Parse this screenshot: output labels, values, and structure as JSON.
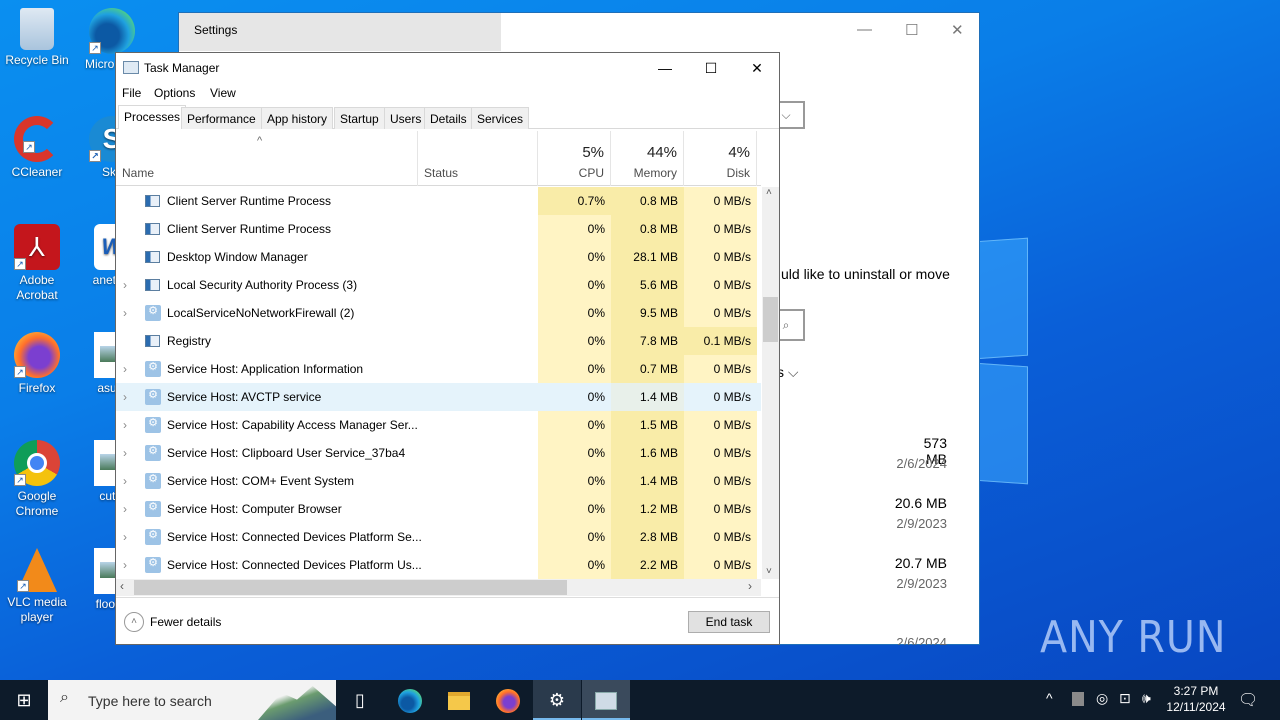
{
  "desktop": {
    "icons": [
      {
        "label": "Recycle Bin",
        "icon": "recycle-bin-icon"
      },
      {
        "label": "Micro Edg",
        "icon": "edge-icon"
      },
      {
        "label": "CCleaner",
        "icon": "ccleaner-icon"
      },
      {
        "label": "Sky",
        "icon": "skype-icon"
      },
      {
        "label": "Adobe Acrobat",
        "icon": "acrobat-icon"
      },
      {
        "label": "anetwo",
        "icon": "word-doc-icon"
      },
      {
        "label": "Firefox",
        "icon": "firefox-icon"
      },
      {
        "label": "asusr",
        "icon": "image-file-icon"
      },
      {
        "label": "Google Chrome",
        "icon": "chrome-icon"
      },
      {
        "label": "cuthi",
        "icon": "image-file-icon"
      },
      {
        "label": "VLC media player",
        "icon": "vlc-icon"
      },
      {
        "label": "floorin",
        "icon": "image-file-icon"
      }
    ],
    "watermark": "ANY RUN"
  },
  "settings_window": {
    "title": "Settings",
    "minimize": "—",
    "maximize": "☐",
    "close": "✕",
    "partial_text": "uld like to uninstall or move",
    "sort_partial": "s",
    "apps": [
      {
        "size": "573 MB",
        "date": "2/6/2024"
      },
      {
        "size": "20.6 MB",
        "date": "2/9/2023"
      },
      {
        "size": "20.7 MB",
        "date": "2/9/2023"
      },
      {
        "size": "",
        "date": "2/6/2024"
      }
    ]
  },
  "task_manager": {
    "title": "Task Manager",
    "window_controls": {
      "minimize": "—",
      "maximize": "☐",
      "close": "✕"
    },
    "menu": [
      "File",
      "Options",
      "View"
    ],
    "tabs": [
      "Processes",
      "Performance",
      "App history",
      "Startup",
      "Users",
      "Details",
      "Services"
    ],
    "active_tab": "Processes",
    "columns": {
      "name": "Name",
      "status": "Status",
      "cpu": {
        "label": "CPU",
        "total": "5%"
      },
      "memory": {
        "label": "Memory",
        "total": "44%"
      },
      "disk": {
        "label": "Disk",
        "total": "4%"
      }
    },
    "processes": [
      {
        "name": "Client Server Runtime Process",
        "icon": "window-icon",
        "expandable": false,
        "cpu": "0.7%",
        "memory": "0.8 MB",
        "disk": "0 MB/s"
      },
      {
        "name": "Client Server Runtime Process",
        "icon": "window-icon",
        "expandable": false,
        "cpu": "0%",
        "memory": "0.8 MB",
        "disk": "0 MB/s"
      },
      {
        "name": "Desktop Window Manager",
        "icon": "window-icon",
        "expandable": false,
        "cpu": "0%",
        "memory": "28.1 MB",
        "disk": "0 MB/s"
      },
      {
        "name": "Local Security Authority Process (3)",
        "icon": "window-icon",
        "expandable": true,
        "cpu": "0%",
        "memory": "5.6 MB",
        "disk": "0 MB/s"
      },
      {
        "name": "LocalServiceNoNetworkFirewall (2)",
        "icon": "gear-icon",
        "expandable": true,
        "cpu": "0%",
        "memory": "9.5 MB",
        "disk": "0 MB/s"
      },
      {
        "name": "Registry",
        "icon": "window-icon",
        "expandable": false,
        "cpu": "0%",
        "memory": "7.8 MB",
        "disk": "0.1 MB/s"
      },
      {
        "name": "Service Host: Application Information",
        "icon": "gear-icon",
        "expandable": true,
        "cpu": "0%",
        "memory": "0.7 MB",
        "disk": "0 MB/s"
      },
      {
        "name": "Service Host: AVCTP service",
        "icon": "gear-icon",
        "expandable": true,
        "cpu": "0%",
        "memory": "1.4 MB",
        "disk": "0 MB/s",
        "selected": true
      },
      {
        "name": "Service Host: Capability Access Manager Ser...",
        "icon": "gear-icon",
        "expandable": true,
        "cpu": "0%",
        "memory": "1.5 MB",
        "disk": "0 MB/s"
      },
      {
        "name": "Service Host: Clipboard User Service_37ba4",
        "icon": "gear-icon",
        "expandable": true,
        "cpu": "0%",
        "memory": "1.6 MB",
        "disk": "0 MB/s"
      },
      {
        "name": "Service Host: COM+ Event System",
        "icon": "gear-icon",
        "expandable": true,
        "cpu": "0%",
        "memory": "1.4 MB",
        "disk": "0 MB/s"
      },
      {
        "name": "Service Host: Computer Browser",
        "icon": "gear-icon",
        "expandable": true,
        "cpu": "0%",
        "memory": "1.2 MB",
        "disk": "0 MB/s"
      },
      {
        "name": "Service Host: Connected Devices Platform Se...",
        "icon": "gear-icon",
        "expandable": true,
        "cpu": "0%",
        "memory": "2.8 MB",
        "disk": "0 MB/s"
      },
      {
        "name": "Service Host: Connected Devices Platform Us...",
        "icon": "gear-icon",
        "expandable": true,
        "cpu": "0%",
        "memory": "2.2 MB",
        "disk": "0 MB/s"
      }
    ],
    "fewer_details": "Fewer details",
    "end_task": "End task",
    "colors": {
      "cpu_bg": "#fff4c4",
      "cpu_hi": "#f9eca8",
      "mem_bg": "#f9eca8",
      "disk_bg": "#fff4c4",
      "selected_bg": "#e5f3fb"
    }
  },
  "taskbar": {
    "search_placeholder": "Type here to search",
    "pinned": [
      "task-view-icon",
      "edge-icon",
      "file-explorer-icon",
      "firefox-icon",
      "settings-gear-icon",
      "task-manager-icon"
    ],
    "tray": {
      "time": "3:27 PM",
      "date": "12/11/2024"
    }
  }
}
